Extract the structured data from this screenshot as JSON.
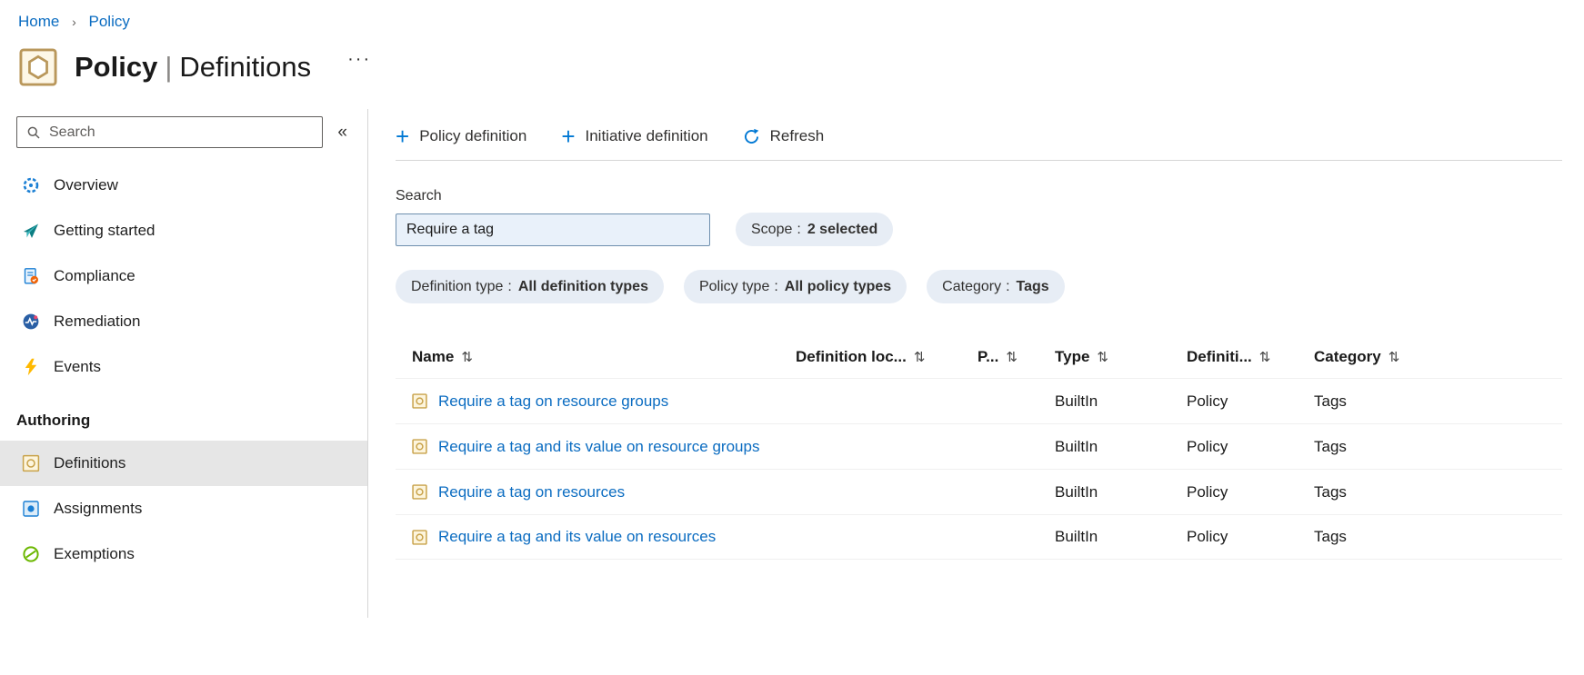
{
  "breadcrumb": {
    "items": [
      {
        "label": "Home"
      },
      {
        "label": "Policy"
      }
    ],
    "separator": "›"
  },
  "header": {
    "title_primary": "Policy",
    "title_separator": "|",
    "title_secondary": "Definitions",
    "more_glyph": "···",
    "icon": "policy-icon"
  },
  "sidebar": {
    "search_placeholder": "Search",
    "collapse_glyph": "«",
    "search_icon": "search-icon",
    "items": [
      {
        "label": "Overview",
        "icon": "overview-icon"
      },
      {
        "label": "Getting started",
        "icon": "getting-started-icon"
      },
      {
        "label": "Compliance",
        "icon": "compliance-icon"
      },
      {
        "label": "Remediation",
        "icon": "remediation-icon"
      },
      {
        "label": "Events",
        "icon": "events-icon"
      }
    ],
    "section_header": "Authoring",
    "authoring_items": [
      {
        "label": "Definitions",
        "icon": "definitions-icon",
        "selected": true
      },
      {
        "label": "Assignments",
        "icon": "assignments-icon",
        "selected": false
      },
      {
        "label": "Exemptions",
        "icon": "exemptions-icon",
        "selected": false
      }
    ]
  },
  "toolbar": {
    "plus_glyph": "+",
    "policy_definition_label": "Policy definition",
    "initiative_definition_label": "Initiative definition",
    "refresh_label": "Refresh",
    "refresh_icon": "refresh-icon"
  },
  "filters": {
    "search_label": "Search",
    "search_value": "Require a tag",
    "pill_separator": ":",
    "pills": [
      {
        "label": "Scope",
        "value": "2 selected"
      },
      {
        "label": "Definition type",
        "value": "All definition types"
      },
      {
        "label": "Policy type",
        "value": "All policy types"
      },
      {
        "label": "Category",
        "value": "Tags"
      }
    ]
  },
  "table": {
    "sort_glyph": "⇅",
    "columns": [
      "Name",
      "Definition loc...",
      "P...",
      "Type",
      "Definiti...",
      "Category"
    ],
    "row_icon": "policy-row-icon",
    "rows": [
      {
        "name": "Require a tag on resource groups",
        "definition_location": "",
        "p": "",
        "type": "BuiltIn",
        "definition_type": "Policy",
        "category": "Tags"
      },
      {
        "name": "Require a tag and its value on resource groups",
        "definition_location": "",
        "p": "",
        "type": "BuiltIn",
        "definition_type": "Policy",
        "category": "Tags"
      },
      {
        "name": "Require a tag on resources",
        "definition_location": "",
        "p": "",
        "type": "BuiltIn",
        "definition_type": "Policy",
        "category": "Tags"
      },
      {
        "name": "Require a tag and its value on resources",
        "definition_location": "",
        "p": "",
        "type": "BuiltIn",
        "definition_type": "Policy",
        "category": "Tags"
      }
    ]
  },
  "colors": {
    "accent_blue": "#0078d4",
    "link_blue": "#0b6cc1",
    "pill_background": "#e7edf5",
    "selected_item_background": "#e6e6e6",
    "divider_gray": "#d6d6d6",
    "events_yellow": "#ffb900",
    "policy_icon_tan": "#b9975b",
    "exemptions_green": "#6bb700"
  }
}
